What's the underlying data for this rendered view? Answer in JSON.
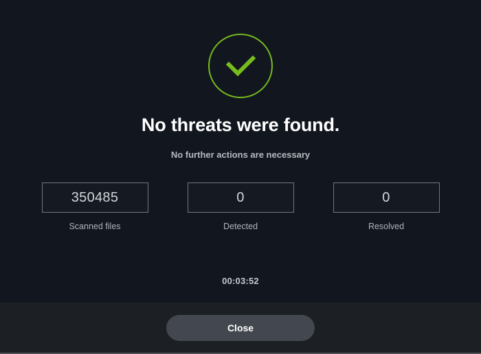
{
  "status": {
    "icon": "check-circle-icon",
    "accent_color": "#77bc1f",
    "headline": "No threats were found.",
    "subtitle": "No further actions are necessary"
  },
  "stats": [
    {
      "value": "350485",
      "label": "Scanned files"
    },
    {
      "value": "0",
      "label": "Detected"
    },
    {
      "value": "0",
      "label": "Resolved"
    }
  ],
  "timer": {
    "elapsed": "00:03:52"
  },
  "footer": {
    "close_label": "Close"
  },
  "colors": {
    "background": "#12161e",
    "footer_background": "#1c1f24",
    "accent_green": "#77bc1f",
    "box_border": "#73777e",
    "button_background": "#43474f"
  }
}
